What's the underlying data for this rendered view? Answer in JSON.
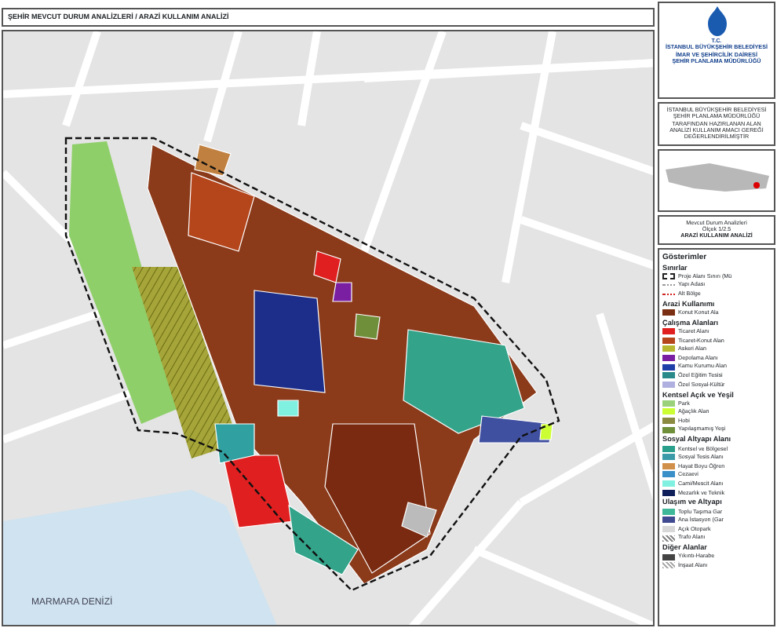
{
  "header": {
    "title": "ŞEHİR MEVCUT DURUM ANALİZLERİ / ARAZİ KULLANIM ANALİZİ"
  },
  "map": {
    "sea_label": "MARMARA DENİZİ"
  },
  "title_block": {
    "org_lines": [
      "T.C.",
      "İSTANBUL BÜYÜKŞEHİR BELEDİYESİ",
      "İMAR VE ŞEHİRCİLİK DAİRESİ",
      "ŞEHİR PLANLAMA MÜDÜRLÜĞÜ"
    ],
    "description": "İSTANBUL BÜYÜKŞEHİR BELEDİYESİ ŞEHİR PLANLAMA MÜDÜRLÜĞÜ TARAFINDAN HAZIRLANAN ALAN ANALİZİ KULLANIM AMACI GEREĞİ DEĞERLENDİRİLMİŞTİR",
    "sheet_title": "Mevcut Durum Analizleri",
    "scale": "Ölçek 1/2.5",
    "sheet_name": "ARAZİ KULLANIM ANALİZİ"
  },
  "legend": {
    "title": "Gösterimler",
    "groups": [
      {
        "title": "Sınırlar",
        "items": [
          {
            "label": "Proje Alanı Sınırı (Mü",
            "kind": "dashed",
            "color": "#222222"
          },
          {
            "label": "Yapı Adası",
            "kind": "dotted",
            "color": "#999999"
          },
          {
            "label": "Alt Bölge",
            "kind": "dotted",
            "color": "#d02020"
          }
        ]
      },
      {
        "title": "Arazi Kullanımı",
        "items": [
          {
            "label": "Konut Konut Ala",
            "kind": "fill",
            "color": "#7a2e12"
          }
        ]
      },
      {
        "title": "Çalışma Alanları",
        "items": [
          {
            "label": "Ticaret Alanı",
            "kind": "fill",
            "color": "#e01f1f"
          },
          {
            "label": "Ticaret-Konut Alan",
            "kind": "fill",
            "color": "#b5451b"
          },
          {
            "label": "Askeri Alan",
            "kind": "fill",
            "color": "#b8b830"
          },
          {
            "label": "Depolama Alanı",
            "kind": "fill",
            "color": "#7b1fa2"
          },
          {
            "label": "Kamu Kurumu Alan",
            "kind": "fill",
            "color": "#1f3fa8"
          },
          {
            "label": "Özel Eğitim Tesisi",
            "kind": "fill",
            "color": "#2a8a8a"
          },
          {
            "label": "Özel Sosyal-Kültür",
            "kind": "fill",
            "color": "#b0b0e0"
          }
        ]
      },
      {
        "title": "Kentsel Açık ve Yeşil",
        "items": [
          {
            "label": "Park",
            "kind": "fill",
            "color": "#9ad17a"
          },
          {
            "label": "Ağaçlık Alan",
            "kind": "fill",
            "color": "#ccff33"
          },
          {
            "label": "Hobi",
            "kind": "fill",
            "color": "#8a8a40"
          },
          {
            "label": "Yapılaşmamış Yeşi",
            "kind": "fill",
            "color": "#6f8f3a"
          }
        ]
      },
      {
        "title": "Sosyal Altyapı Alanı",
        "items": [
          {
            "label": "Kentsel ve Bölgesel",
            "kind": "fill",
            "color": "#2aa08c"
          },
          {
            "label": "Sosyal Tesis Alanı",
            "kind": "fill",
            "color": "#3a9aa8"
          },
          {
            "label": "Hayat Boyu Öğren",
            "kind": "fill",
            "color": "#d0904a"
          },
          {
            "label": "Cezaevi",
            "kind": "fill",
            "color": "#3a8fc8"
          },
          {
            "label": "Cami/Mescit Alanı",
            "kind": "fill",
            "color": "#80f0e0"
          },
          {
            "label": "Mezarlık ve Teknik",
            "kind": "fill",
            "color": "#0f1f5a"
          }
        ]
      },
      {
        "title": "Ulaşım ve Altyapı",
        "items": [
          {
            "label": "Toplu Taşıma Gar",
            "kind": "fill",
            "color": "#3fb89a"
          },
          {
            "label": "Ana İstasyon (Gar",
            "kind": "fill",
            "color": "#404a90"
          },
          {
            "label": "Açık Otopark",
            "kind": "fill",
            "color": "#d8d8d8"
          },
          {
            "label": "Trafo Alanı",
            "kind": "hatch",
            "color": "#888888"
          }
        ]
      },
      {
        "title": "Diğer Alanlar",
        "items": [
          {
            "label": "Yıkıntı-Harabe",
            "kind": "fill",
            "color": "#444444"
          },
          {
            "label": "İnşaat Alanı",
            "kind": "hatch",
            "color": "#aaaaaa"
          }
        ]
      }
    ]
  }
}
